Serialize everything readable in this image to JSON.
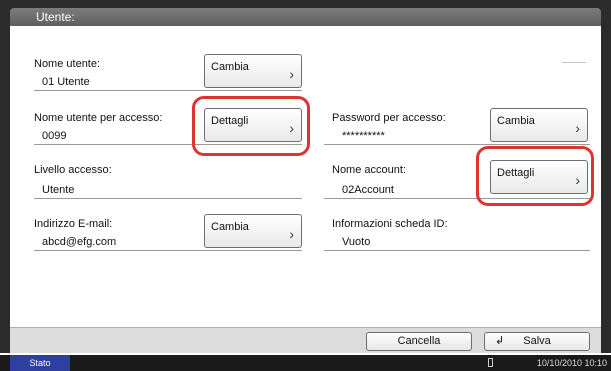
{
  "header": {
    "title": "Utente:"
  },
  "fields": {
    "user_name": {
      "label": "Nome utente:",
      "value": "01 Utente",
      "button": "Cambia"
    },
    "login_user": {
      "label": "Nome utente per accesso:",
      "value": "0099",
      "button": "Dettagli"
    },
    "login_password": {
      "label": "Password per accesso:",
      "value": "**********",
      "button": "Cambia"
    },
    "access_level": {
      "label": "Livello accesso:",
      "value": "Utente"
    },
    "account_name": {
      "label": "Nome account:",
      "value": "02Account",
      "button": "Dettagli"
    },
    "email": {
      "label": "Indirizzo E-mail:",
      "value": "abcd@efg.com",
      "button": "Cambia"
    },
    "id_card": {
      "label": "Informazioni scheda ID:",
      "value": "Vuoto"
    }
  },
  "footer": {
    "cancel": "Cancella",
    "save": "Salva"
  },
  "status": {
    "label": "Stato",
    "datetime": "10/10/2010  10:10"
  },
  "colors": {
    "highlight": "#e0332e",
    "status_badge": "#2f3f9f",
    "header": "#6e6e6e"
  },
  "icons": {
    "chevron": "chevron-right-icon",
    "enter": "enter-icon"
  }
}
